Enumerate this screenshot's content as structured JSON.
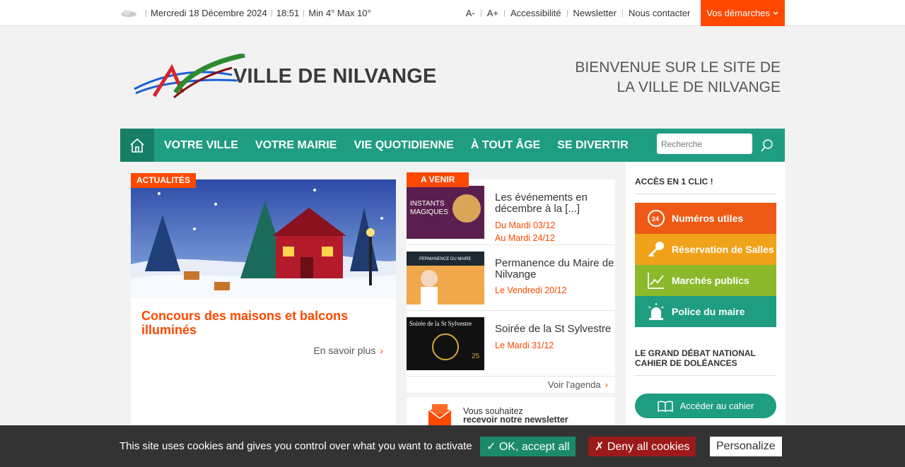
{
  "topbar": {
    "date": "Mercredi 18 Décembre 2024",
    "time": "18:51",
    "weather": "Min 4° Max 10°",
    "links": [
      "A-",
      "A+",
      "Accessibilité",
      "Newsletter",
      "Nous contacter"
    ],
    "demarches": "Vos démarches"
  },
  "header": {
    "brand": "VILLE DE NILVANGE",
    "welcome_line1": "BIENVENUE SUR LE SITE DE",
    "welcome_line2": "LA VILLE DE NILVANGE"
  },
  "nav": {
    "items": [
      "VOTRE VILLE",
      "VOTRE MAIRIE",
      "VIE QUOTIDIENNE",
      "À TOUT ÂGE",
      "SE DIVERTIR"
    ],
    "search_placeholder": "Recherche"
  },
  "news": {
    "badge": "ACTUALITÉS",
    "title": "Concours des maisons et balcons illuminés",
    "more": "En savoir plus"
  },
  "events": {
    "badge": "A VENIR",
    "items": [
      {
        "title": "Les événements en décembre à la [...]",
        "date1": "Du Mardi 03/12",
        "date2": "Au Mardi 24/12",
        "thumb_text": "INSTANTS MAGIQUES"
      },
      {
        "title": "Permanence du Maire de Nilvange",
        "date1": "Le Vendredi 20/12",
        "thumb_text": "PERMANENCE DU MAIRE"
      },
      {
        "title": "Soirée de la St Sylvestre",
        "date1": "Le Mardi 31/12",
        "thumb_text": "Soirée de la St Sylvestre"
      }
    ],
    "agenda": "Voir l'agenda"
  },
  "newsletter": {
    "line1": "Vous souhaitez",
    "line2": "recevoir notre newsletter"
  },
  "side": {
    "heading1": "ACCÈS EN 1 CLIC !",
    "quick": [
      {
        "label": "Numéros utiles",
        "color": "#ee5a16"
      },
      {
        "label": "Réservation de Salles",
        "color": "#f0a21a"
      },
      {
        "label": "Marchés publics",
        "color": "#8bb92c"
      },
      {
        "label": "Police du maire",
        "color": "#1f9d80"
      }
    ],
    "heading2_line1": "LE GRAND DÉBAT NATIONAL",
    "heading2_line2": "CAHIER DE DOLÉANCES",
    "cahier": "Accéder au cahier"
  },
  "cookie": {
    "text": "This site uses cookies and gives you control over what you want to activate",
    "ok": "✓ OK, accept all",
    "deny": "✗ Deny all cookies",
    "personalize": "Personalize"
  },
  "colors": {
    "green": "#1f9d80",
    "orange": "#ff4800"
  }
}
